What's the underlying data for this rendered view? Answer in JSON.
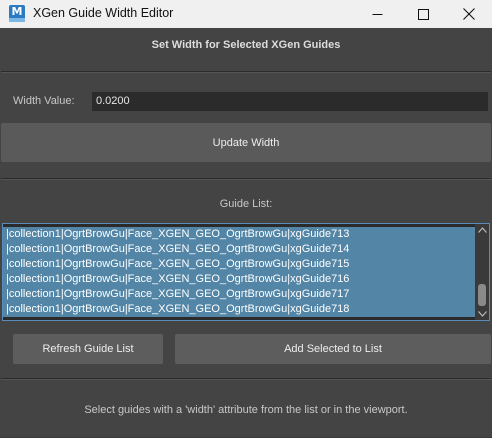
{
  "window": {
    "title": "XGen Guide Width Editor",
    "icon_text": "M",
    "controls": [
      "minimize-icon",
      "maximize-icon",
      "close-icon"
    ]
  },
  "header": {
    "title": "Set Width for Selected XGen Guides"
  },
  "width": {
    "label": "Width Value:",
    "value": "0.0200"
  },
  "buttons": {
    "update": "Update Width",
    "refresh": "Refresh Guide List",
    "add_selected": "Add Selected to List"
  },
  "guide_list": {
    "label": "Guide List:",
    "items": [
      "|collection1|OgrtBrowGu|Face_XGEN_GEO_OgrtBrowGu|xgGuide713",
      "|collection1|OgrtBrowGu|Face_XGEN_GEO_OgrtBrowGu|xgGuide714",
      "|collection1|OgrtBrowGu|Face_XGEN_GEO_OgrtBrowGu|xgGuide715",
      "|collection1|OgrtBrowGu|Face_XGEN_GEO_OgrtBrowGu|xgGuide716",
      "|collection1|OgrtBrowGu|Face_XGEN_GEO_OgrtBrowGu|xgGuide717",
      "|collection1|OgrtBrowGu|Face_XGEN_GEO_OgrtBrowGu|xgGuide718"
    ]
  },
  "footer": {
    "hint": "Select guides with a 'width' attribute from the list or in the viewport."
  },
  "colors": {
    "background": "#444444",
    "selection": "#5285a6",
    "field": "#2b2b2b",
    "button": "#5d5d5d"
  }
}
